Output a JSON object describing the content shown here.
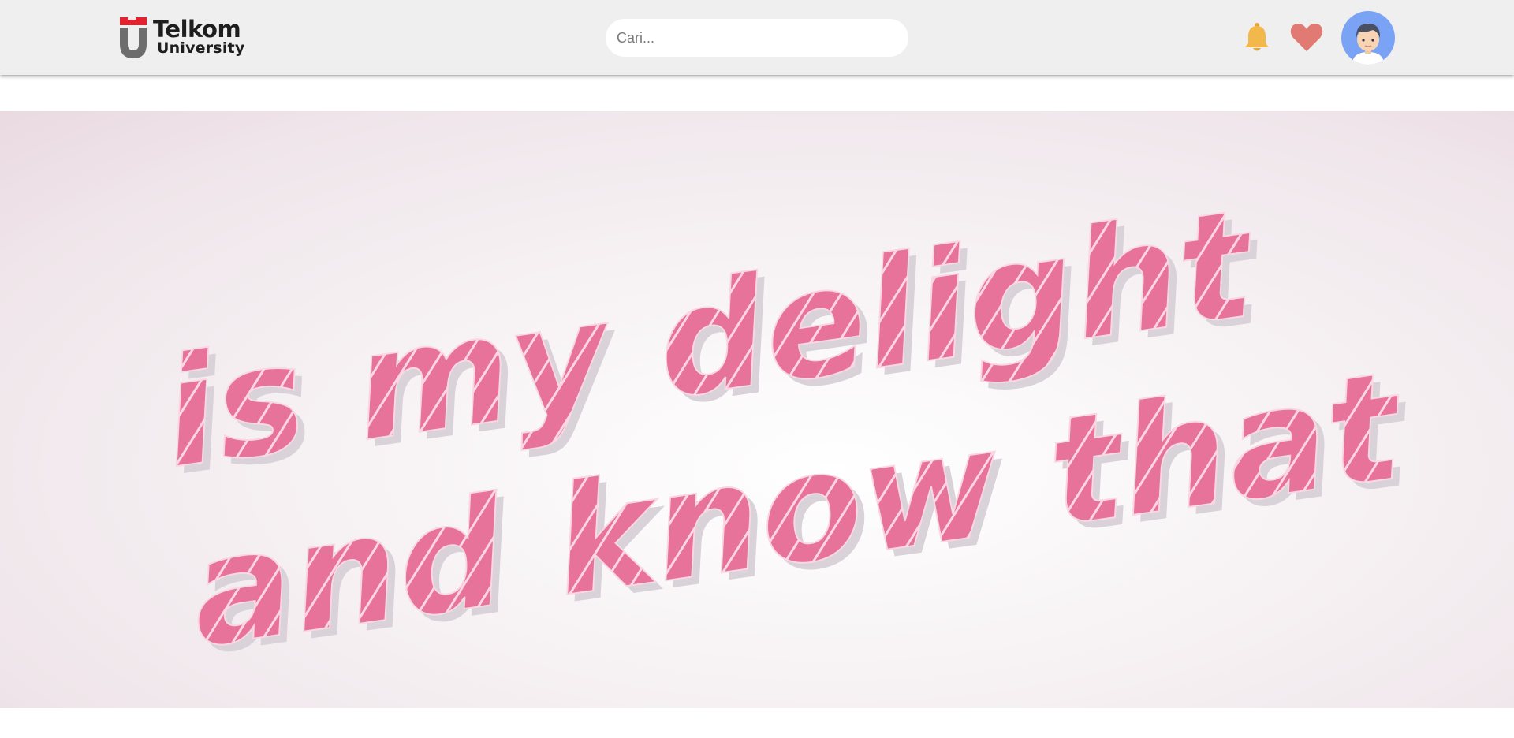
{
  "header": {
    "logo": {
      "line1": "Telkom",
      "line2": "University",
      "icon": "telkom-university-logo-icon"
    },
    "search": {
      "placeholder": "Cari..."
    },
    "icons": {
      "notifications": "bell-icon",
      "favorites": "heart-icon",
      "profile": "avatar-icon"
    }
  },
  "hero": {
    "line1": "is my delight",
    "line2": "and know that"
  },
  "colors": {
    "navbar_bg": "#efefef",
    "bell": "#f2b84b",
    "heart": "#e07a72",
    "avatar_bg": "#7aa3f5",
    "hero_text": "#e8739a",
    "logo_red": "#e0232f",
    "logo_gray": "#6d6d6d"
  }
}
